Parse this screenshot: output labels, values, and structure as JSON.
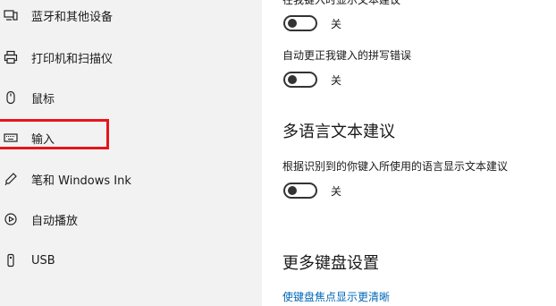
{
  "sidebar": {
    "items": [
      {
        "label": "蓝牙和其他设备",
        "icon": "bluetooth-devices-icon"
      },
      {
        "label": "打印机和扫描仪",
        "icon": "printer-icon"
      },
      {
        "label": "鼠标",
        "icon": "mouse-icon"
      },
      {
        "label": "输入",
        "icon": "keyboard-icon"
      },
      {
        "label": "笔和 Windows Ink",
        "icon": "pen-icon"
      },
      {
        "label": "自动播放",
        "icon": "autoplay-icon"
      },
      {
        "label": "USB",
        "icon": "usb-icon"
      }
    ],
    "selected": "输入"
  },
  "main": {
    "top_cut_label": "在我键入时显示文本建议",
    "toggle1_state": "关",
    "autocorrect_label": "自动更正我键入的拼写错误",
    "toggle2_state": "关",
    "multilang_heading": "多语言文本建议",
    "multilang_label": "根据识别到的你键入所使用的语言显示文本建议",
    "toggle3_state": "关",
    "more_heading": "更多键盘设置",
    "more_link": "使键盘焦点显示更清晰"
  },
  "colors": {
    "sidebar_bg": "#f2f2f2",
    "highlight_box": "#e8141b",
    "link": "#0067b8"
  }
}
